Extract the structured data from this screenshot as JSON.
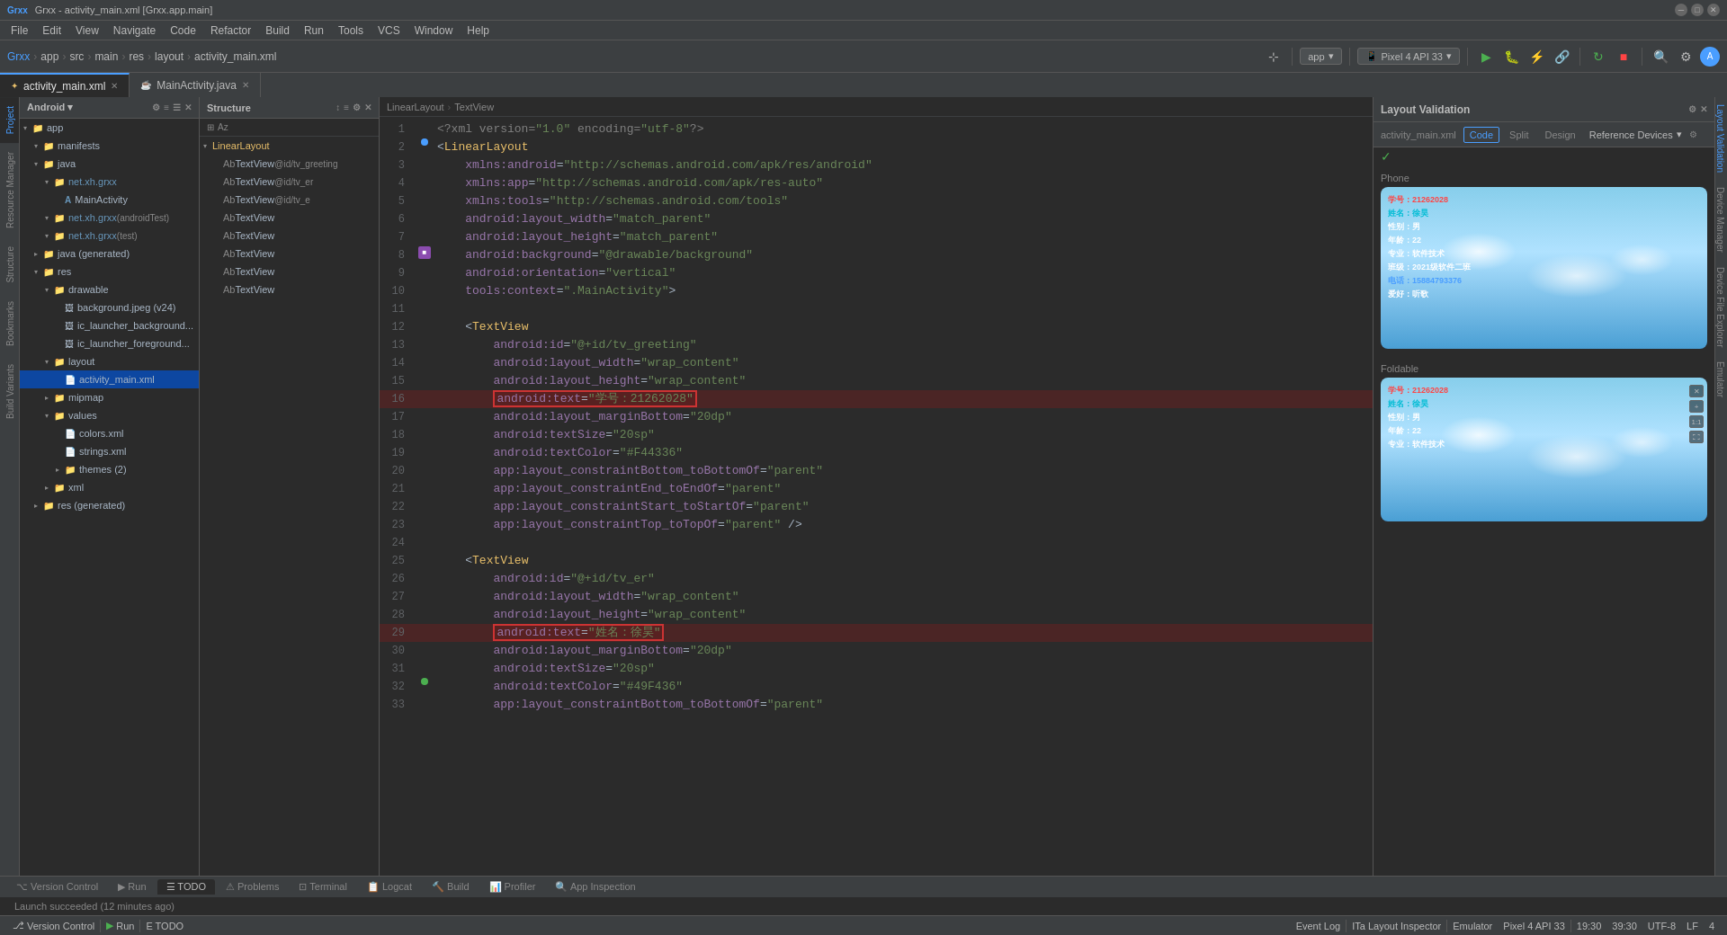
{
  "titleBar": {
    "title": "Grxx - activity_main.xml [Grxx.app.main]",
    "menuItems": [
      "File",
      "Edit",
      "View",
      "Navigate",
      "Code",
      "Refactor",
      "Build",
      "Run",
      "Tools",
      "VCS",
      "Window",
      "Help"
    ]
  },
  "toolbar": {
    "breadcrumb": [
      "Grxx",
      "app",
      "src",
      "main",
      "res",
      "layout",
      "activity_main.xml"
    ],
    "runConfig": "app",
    "deviceConfig": "Pixel 4 API 33",
    "apiLevel": "33"
  },
  "tabs": [
    {
      "label": "activity_main.xml",
      "active": true,
      "icon": "xml"
    },
    {
      "label": "MainActivity.java",
      "active": false,
      "icon": "java"
    }
  ],
  "projectPanel": {
    "title": "Project",
    "androidMode": "Android",
    "tree": [
      {
        "level": 0,
        "arrow": "▾",
        "icon": "📁",
        "label": "app",
        "type": "folder"
      },
      {
        "level": 1,
        "arrow": "▾",
        "icon": "📁",
        "label": "manifests",
        "type": "folder"
      },
      {
        "level": 1,
        "arrow": "▾",
        "icon": "📁",
        "label": "java",
        "type": "folder"
      },
      {
        "level": 2,
        "arrow": "▾",
        "icon": "📁",
        "label": "net.xh.grxx",
        "type": "folder"
      },
      {
        "level": 3,
        "arrow": " ",
        "icon": "🅰",
        "label": "MainActivity",
        "type": "class"
      },
      {
        "level": 2,
        "arrow": "▾",
        "icon": "📁",
        "label": "net.xh.grxx (androidTest)",
        "type": "folder"
      },
      {
        "level": 2,
        "arrow": "▾",
        "icon": "📁",
        "label": "net.xh.grxx (test)",
        "type": "folder"
      },
      {
        "level": 1,
        "arrow": "▸",
        "icon": "📁",
        "label": "java (generated)",
        "type": "folder"
      },
      {
        "level": 1,
        "arrow": "▾",
        "icon": "📁",
        "label": "res",
        "type": "folder"
      },
      {
        "level": 2,
        "arrow": "▾",
        "icon": "📁",
        "label": "drawable",
        "type": "folder"
      },
      {
        "level": 3,
        "arrow": " ",
        "icon": "🖼",
        "label": "background.jpeg (v24)",
        "type": "file"
      },
      {
        "level": 3,
        "arrow": " ",
        "icon": "🖼",
        "label": "ic_launcher_background...",
        "type": "file"
      },
      {
        "level": 3,
        "arrow": " ",
        "icon": "🖼",
        "label": "ic_launcher_foreground...",
        "type": "file"
      },
      {
        "level": 2,
        "arrow": "▾",
        "icon": "📁",
        "label": "layout",
        "type": "folder"
      },
      {
        "level": 3,
        "arrow": " ",
        "icon": "📄",
        "label": "activity_main.xml",
        "type": "xml",
        "selected": true
      },
      {
        "level": 2,
        "arrow": "▸",
        "icon": "📁",
        "label": "mipmap",
        "type": "folder"
      },
      {
        "level": 2,
        "arrow": "▾",
        "icon": "📁",
        "label": "values",
        "type": "folder"
      },
      {
        "level": 3,
        "arrow": " ",
        "icon": "📄",
        "label": "colors.xml",
        "type": "file"
      },
      {
        "level": 3,
        "arrow": " ",
        "icon": "📄",
        "label": "strings.xml",
        "type": "file"
      },
      {
        "level": 3,
        "arrow": " ",
        "icon": "📁",
        "label": "themes (2)",
        "type": "folder"
      },
      {
        "level": 2,
        "arrow": "▸",
        "icon": "📁",
        "label": "xml",
        "type": "folder"
      },
      {
        "level": 1,
        "arrow": "▸",
        "icon": "📁",
        "label": "res (generated)",
        "type": "folder"
      }
    ]
  },
  "structurePanel": {
    "title": "Structure",
    "items": [
      {
        "level": 0,
        "arrow": "▾",
        "label": "LinearLayout"
      },
      {
        "level": 1,
        "arrow": " ",
        "label": "Ab TextView",
        "id": "@id/tv_greeting"
      },
      {
        "level": 1,
        "arrow": " ",
        "label": "Ab TextView",
        "id": "@id/tv_er"
      },
      {
        "level": 1,
        "arrow": " ",
        "label": "Ab TextView",
        "id": "@id/tv_e"
      },
      {
        "level": 1,
        "arrow": " ",
        "label": "Ab TextView"
      },
      {
        "level": 1,
        "arrow": " ",
        "label": "Ab TextView"
      },
      {
        "level": 1,
        "arrow": " ",
        "label": "Ab TextView"
      },
      {
        "level": 1,
        "arrow": " ",
        "label": "Ab TextView"
      },
      {
        "level": 1,
        "arrow": " ",
        "label": "Ab TextView"
      }
    ]
  },
  "codeLines": [
    {
      "num": 1,
      "gutter": "",
      "code": "<?xml version=\"1.0\" encoding=\"utf-8\"?>"
    },
    {
      "num": 2,
      "gutter": "blue",
      "code": "<LinearLayout"
    },
    {
      "num": 3,
      "gutter": "",
      "code": "    xmlns:android=\"http://schemas.android.com/apk/res/android\""
    },
    {
      "num": 4,
      "gutter": "",
      "code": "    xmlns:app=\"http://schemas.android.com/apk/res-auto\""
    },
    {
      "num": 5,
      "gutter": "",
      "code": "    xmlns:tools=\"http://schemas.android.com/tools\""
    },
    {
      "num": 6,
      "gutter": "",
      "code": "    android:layout_width=\"match_parent\""
    },
    {
      "num": 7,
      "gutter": "",
      "code": "    android:layout_height=\"match_parent\""
    },
    {
      "num": 8,
      "gutter": "",
      "code": "    android:background=\"@drawable/background\""
    },
    {
      "num": 9,
      "gutter": "",
      "code": "    android:orientation=\"vertical\""
    },
    {
      "num": 10,
      "gutter": "",
      "code": "    tools:context=\".MainActivity\">"
    },
    {
      "num": 11,
      "gutter": "",
      "code": ""
    },
    {
      "num": 12,
      "gutter": "",
      "code": "    <TextView"
    },
    {
      "num": 13,
      "gutter": "",
      "code": "        android:id=\"@+id/tv_greeting\""
    },
    {
      "num": 14,
      "gutter": "",
      "code": "        android:layout_width=\"wrap_content\""
    },
    {
      "num": 15,
      "gutter": "",
      "code": "        android:layout_height=\"wrap_content\""
    },
    {
      "num": 16,
      "gutter": "",
      "code": "        android:text=\"学号：21262028\"",
      "highlight": true
    },
    {
      "num": 17,
      "gutter": "",
      "code": "        android:layout_marginBottom=\"20dp\""
    },
    {
      "num": 18,
      "gutter": "",
      "code": "        android:textSize=\"20sp\""
    },
    {
      "num": 19,
      "gutter": "",
      "code": "        android:textColor=\"#F44336\""
    },
    {
      "num": 20,
      "gutter": "",
      "code": "        app:layout_constraintBottom_toBottomOf=\"parent\""
    },
    {
      "num": 21,
      "gutter": "",
      "code": "        app:layout_constraintEnd_toEndOf=\"parent\""
    },
    {
      "num": 22,
      "gutter": "",
      "code": "        app:layout_constraintStart_toStartOf=\"parent\""
    },
    {
      "num": 23,
      "gutter": "",
      "code": "        app:layout_constraintTop_toTopOf=\"parent\" />"
    },
    {
      "num": 24,
      "gutter": "",
      "code": ""
    },
    {
      "num": 25,
      "gutter": "",
      "code": "    <TextView"
    },
    {
      "num": 26,
      "gutter": "",
      "code": "        android:id=\"@+id/tv_er\""
    },
    {
      "num": 27,
      "gutter": "",
      "code": "        android:layout_width=\"wrap_content\""
    },
    {
      "num": 28,
      "gutter": "",
      "code": "        android:layout_height=\"wrap_content\""
    },
    {
      "num": 29,
      "gutter": "",
      "code": "        android:text=\"姓名：徐昊\"",
      "highlight": true
    },
    {
      "num": 30,
      "gutter": "",
      "code": "        android:layout_marginBottom=\"20dp\""
    },
    {
      "num": 31,
      "gutter": "",
      "code": "        android:textSize=\"20sp\""
    },
    {
      "num": 32,
      "gutter": "green",
      "code": "        android:textColor=\"#49F436\""
    },
    {
      "num": 33,
      "gutter": "",
      "code": "        app:layout_constraintBottom_toBottomOf=\"parent\""
    }
  ],
  "validationPanel": {
    "title": "Layout Validation",
    "currentFile": "activity_main.xml",
    "viewModes": [
      "Code",
      "Split",
      "Design"
    ],
    "activeViewMode": "Code",
    "referenceDevicesLabel": "Reference Devices",
    "checkMark": "✓",
    "phoneSectionLabel": "Phone",
    "foldableSectionLabel": "Foldable",
    "phonePreview": {
      "texts": [
        {
          "text": "学号：21262028",
          "color": "red"
        },
        {
          "text": "姓名：徐昊",
          "color": "cyan"
        },
        {
          "text": "性别：男",
          "color": "white"
        },
        {
          "text": "年龄：22",
          "color": "white"
        },
        {
          "text": "专业：软件技术",
          "color": "white"
        },
        {
          "text": "班级：2021级软件二班",
          "color": "white"
        },
        {
          "text": "电话：15884793376",
          "color": "blue"
        },
        {
          "text": "爱好：听歌",
          "color": "white"
        }
      ]
    },
    "foldablePreview": {
      "texts": [
        {
          "text": "学号：21262028",
          "color": "red"
        },
        {
          "text": "姓名：徐昊",
          "color": "cyan"
        },
        {
          "text": "性别：男",
          "color": "white"
        },
        {
          "text": "年龄：22",
          "color": "white"
        },
        {
          "text": "专业：软件技术",
          "color": "white"
        }
      ]
    }
  },
  "breadcrumb": {
    "items": [
      "LinearLayout",
      "TextView"
    ]
  },
  "bottomTabs": [
    "Version Control",
    "Run",
    "TODO",
    "Problems",
    "Terminal",
    "Logcat",
    "Build",
    "Profiler",
    "App Inspection"
  ],
  "statusBar": {
    "versionControl": "Version Control",
    "run": "Run",
    "todo": "E TODO",
    "launchStatus": "Launch succeeded (12 minutes ago)",
    "emulator": "Emulator",
    "device": "Pixel 4 API 33",
    "lineCol": "39:30",
    "encoding": "UTF-8",
    "indentation": "LF",
    "spaces": "4",
    "layoutInspector": "ITa Layout Inspector",
    "time": "19:30"
  }
}
